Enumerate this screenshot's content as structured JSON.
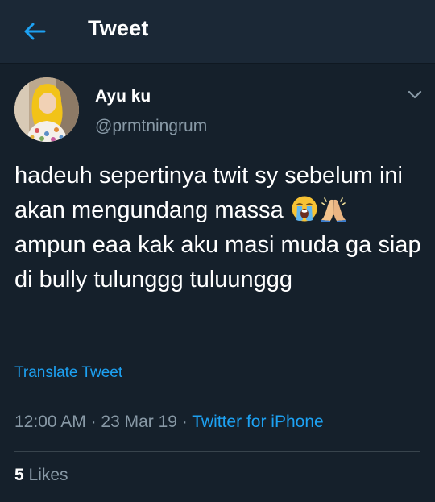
{
  "header": {
    "title": "Tweet"
  },
  "tweet": {
    "author_name": "Ayu ku",
    "author_handle": "@prmtningrum",
    "text_part1": "hadeuh sepertinya twit sy sebelum ini akan mengundang massa",
    "emojis": [
      "loudly-crying-face-icon",
      "folded-hands-icon"
    ],
    "text_part2": "ampun eaa kak aku masi muda ga siap di bully tulunggg tuluunggg",
    "translate_label": "Translate Tweet",
    "time": "12:00 AM",
    "separator": " · ",
    "date": "23 Mar 19",
    "source": "Twitter for iPhone",
    "likes_count": "5",
    "likes_label": "Likes"
  },
  "colors": {
    "background": "#15202b",
    "header_bg": "#1b2836",
    "accent": "#1da1f2",
    "secondary_text": "#8899a6",
    "divider": "#38444d"
  }
}
